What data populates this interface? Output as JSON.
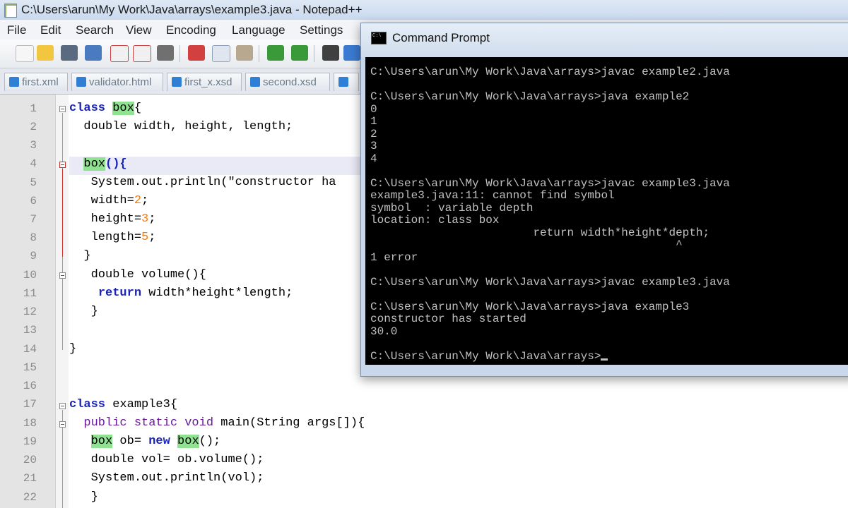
{
  "notepad": {
    "title": "C:\\Users\\arun\\My Work\\Java\\arrays\\example3.java - Notepad++",
    "menu": [
      "File",
      "Edit",
      "Search",
      "View",
      "Encoding",
      "Language",
      "Settings"
    ],
    "tabs": [
      "first.xml",
      "validator.html",
      "first_x.xsd",
      "second.xsd"
    ],
    "line_numbers": [
      "1",
      "2",
      "3",
      "4",
      "5",
      "6",
      "7",
      "8",
      "9",
      "10",
      "11",
      "12",
      "13",
      "14",
      "15",
      "16",
      "17",
      "18",
      "19",
      "20",
      "21",
      "22"
    ]
  },
  "code": {
    "l1": {
      "kw": "class",
      "name": "box",
      "tail": "{"
    },
    "l2": "double width, height, length;",
    "l4": {
      "name": "box",
      "tail": "(){"
    },
    "l5": "System.out.println(\"constructor ha",
    "l6": {
      "pre": "width=",
      "num": "2",
      "post": ";"
    },
    "l7": {
      "pre": "height=",
      "num": "3",
      "post": ";"
    },
    "l8": {
      "pre": "length=",
      "num": "5",
      "post": ";"
    },
    "l9": "}",
    "l10": "double volume(){",
    "l11": {
      "kw": "return",
      "rest": " width*height*length;"
    },
    "l12": "}",
    "l14": "}",
    "l17": {
      "kw": "class",
      "rest": " example3{"
    },
    "l18": {
      "kw": "public static void",
      "rest": " main(String args[]){"
    },
    "l19": {
      "name": "box",
      "mid": " ob= ",
      "kw": "new",
      "name2": "box",
      "tail": "();"
    },
    "l20": "double vol= ob.volume();",
    "l21": "System.out.println(vol);",
    "l22": "}"
  },
  "cmd": {
    "title": "Command Prompt",
    "lines": [
      "C:\\Users\\arun\\My Work\\Java\\arrays>javac example2.java",
      "",
      "C:\\Users\\arun\\My Work\\Java\\arrays>java example2",
      "0",
      "1",
      "2",
      "3",
      "4",
      "",
      "C:\\Users\\arun\\My Work\\Java\\arrays>javac example3.java",
      "example3.java:11: cannot find symbol",
      "symbol  : variable depth",
      "location: class box",
      "                        return width*height*depth;",
      "                                             ^",
      "1 error",
      "",
      "C:\\Users\\arun\\My Work\\Java\\arrays>javac example3.java",
      "",
      "C:\\Users\\arun\\My Work\\Java\\arrays>java example3",
      "constructor has started",
      "30.0",
      "",
      "C:\\Users\\arun\\My Work\\Java\\arrays>"
    ]
  }
}
